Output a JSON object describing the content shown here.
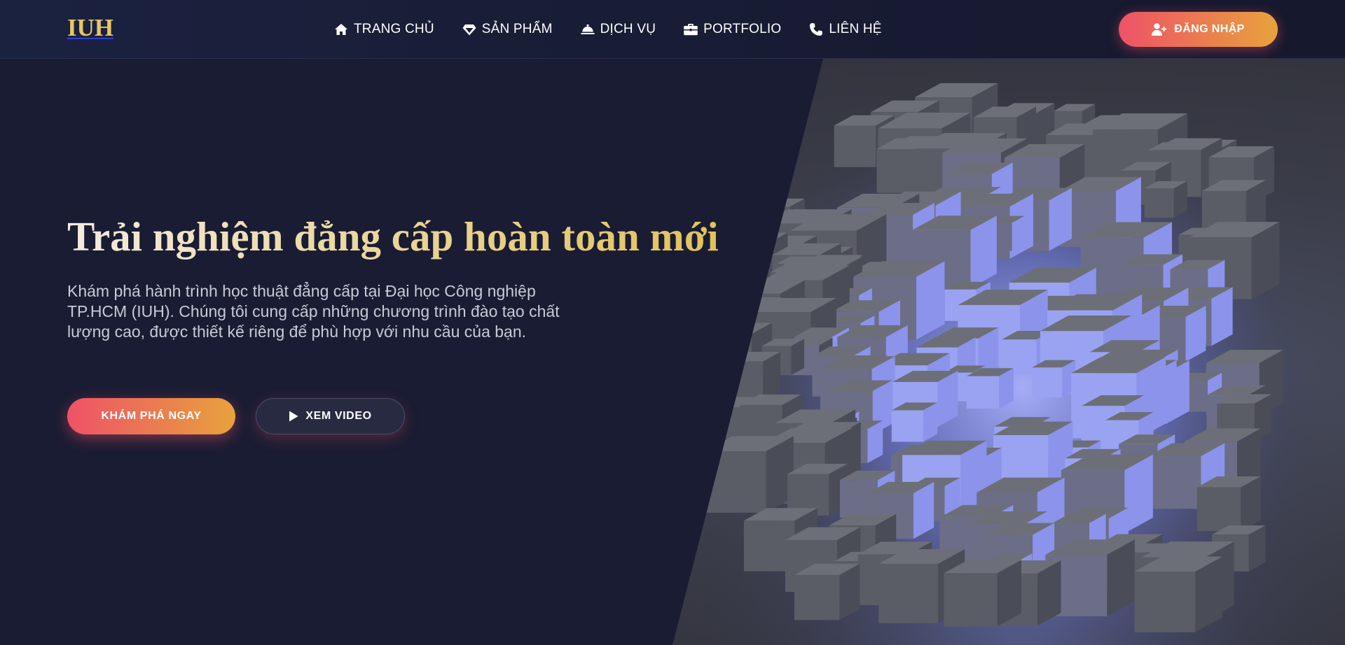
{
  "header": {
    "logo": "IUH",
    "nav": [
      {
        "label": "TRANG CHỦ",
        "icon": "home-icon"
      },
      {
        "label": "SẢN PHẨM",
        "icon": "diamond-icon"
      },
      {
        "label": "DỊCH VỤ",
        "icon": "concierge-bell-icon"
      },
      {
        "label": "PORTFOLIO",
        "icon": "briefcase-icon"
      },
      {
        "label": "LIÊN HỆ",
        "icon": "phone-icon"
      }
    ],
    "login_label": "ĐĂNG NHẬP",
    "login_icon": "user-plus-icon"
  },
  "hero": {
    "title": "Trải nghiệm đẳng cấp hoàn toàn mới",
    "description": "Khám phá hành trình học thuật đẳng cấp tại Đại học Công nghiệp TP.HCM (IUH). Chúng tôi cung cấp những chương trình đào tạo chất lượng cao, được thiết kế riêng để phù hợp với nhu cầu của bạn.",
    "explore_label": "KHÁM PHÁ NGAY",
    "video_label": "XEM VIDEO",
    "video_icon": "play-icon",
    "image": "glowing-cube-blocks-image"
  },
  "colors": {
    "background": "#1a1c33",
    "accent_gold": "#e2c25a",
    "gradient_start": "#ee5267",
    "gradient_end": "#e8a23c",
    "cube_glow": "#7b86e6"
  }
}
